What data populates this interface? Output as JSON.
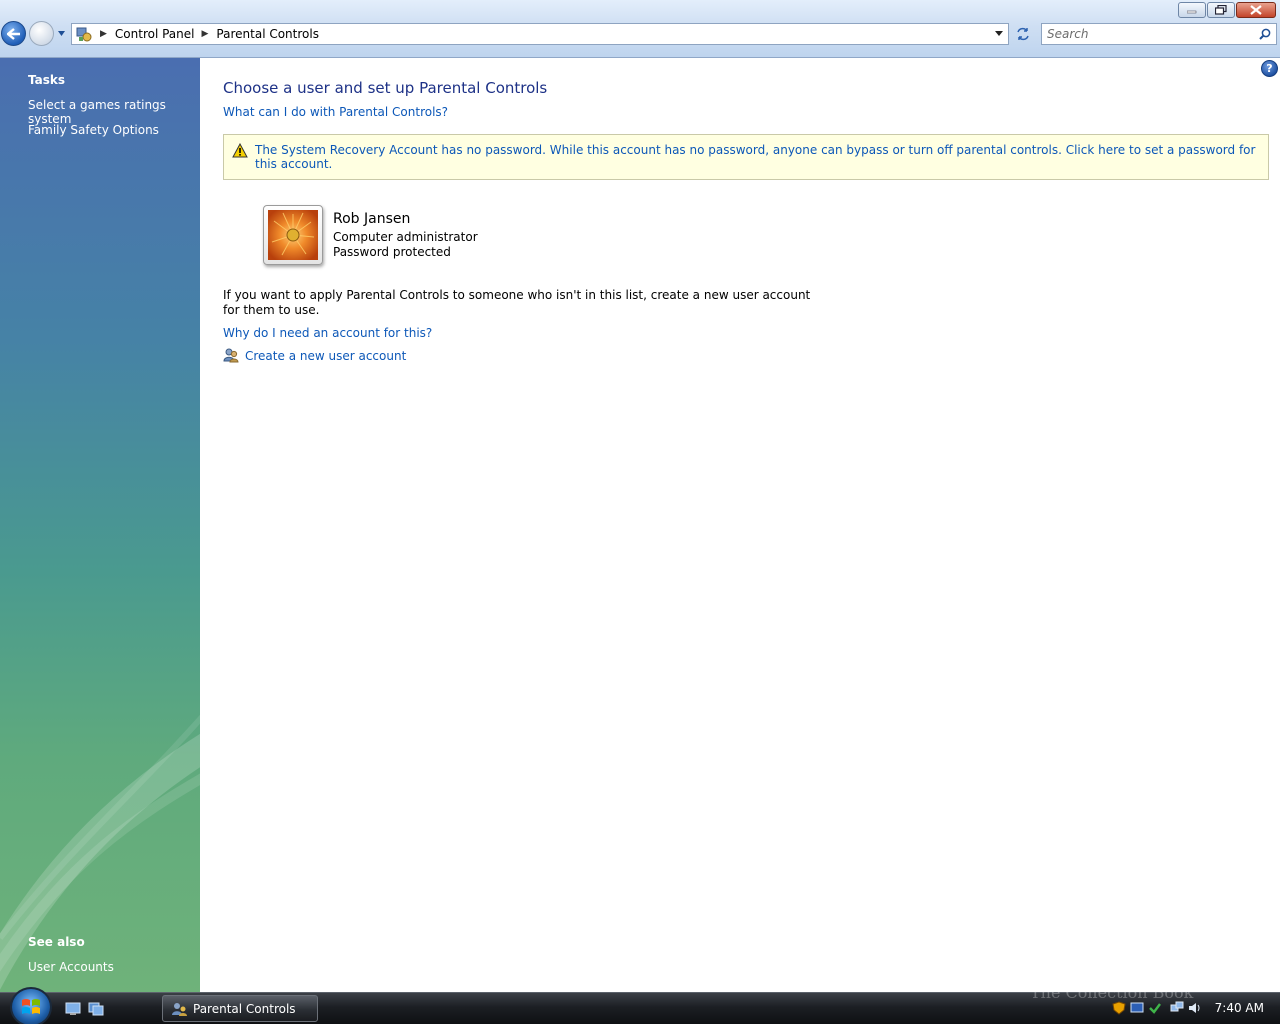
{
  "address_bar": {
    "breadcrumbs": [
      "Control Panel",
      "Parental Controls"
    ]
  },
  "search": {
    "placeholder": "Search"
  },
  "left_pane": {
    "tasks_heading": "Tasks",
    "tasks": [
      "Select a games ratings system",
      "Family Safety Options"
    ],
    "see_also_heading": "See also",
    "see_also": [
      "User Accounts"
    ]
  },
  "main": {
    "title": "Choose a user and set up Parental Controls",
    "help_link": "What can I do with Parental Controls?",
    "warning": "The System Recovery Account has no password. While this account has no password, anyone can bypass or turn off parental controls. Click here to set a password for this account.",
    "user": {
      "name": "Rob Jansen",
      "role": "Computer administrator",
      "password_status": "Password protected"
    },
    "info_text": "If you want to apply Parental Controls to someone who isn't in this list, create a new user account for them to use.",
    "why_link": "Why do I need an account for this?",
    "create_link": "Create a new user account"
  },
  "taskbar": {
    "active_window": "Parental Controls",
    "clock": "7:40 AM",
    "watermark": "The Collection Book"
  },
  "colors": {
    "link": "#0d58b8",
    "title": "#1e3287",
    "warning_bg": "#ffffe1"
  }
}
